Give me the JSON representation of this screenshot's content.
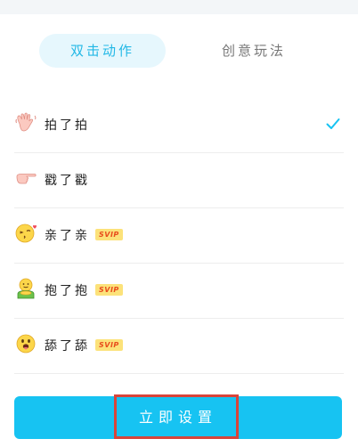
{
  "tabs": [
    {
      "label": "双击动作",
      "active": true
    },
    {
      "label": "创意玩法",
      "active": false
    }
  ],
  "actions": [
    {
      "icon": "waving-hand-icon",
      "label": "拍了拍",
      "svip": "",
      "selected": true
    },
    {
      "icon": "pointing-hand-icon",
      "label": "戳了戳",
      "svip": "",
      "selected": false
    },
    {
      "icon": "kissing-face-icon",
      "label": "亲了亲",
      "svip": "SVIP",
      "selected": false
    },
    {
      "icon": "hugging-emoji-icon",
      "label": "抱了抱",
      "svip": "SVIP",
      "selected": false
    },
    {
      "icon": "tongue-face-icon",
      "label": "舔了舔",
      "svip": "SVIP",
      "selected": false
    }
  ],
  "cta": {
    "label": "立即设置"
  },
  "colors": {
    "accent": "#17c3f2",
    "tab_active_bg": "#e6f7fd",
    "svip_bg": "#fce27a",
    "svip_text": "#e84c1c",
    "highlight": "#d9443a"
  }
}
